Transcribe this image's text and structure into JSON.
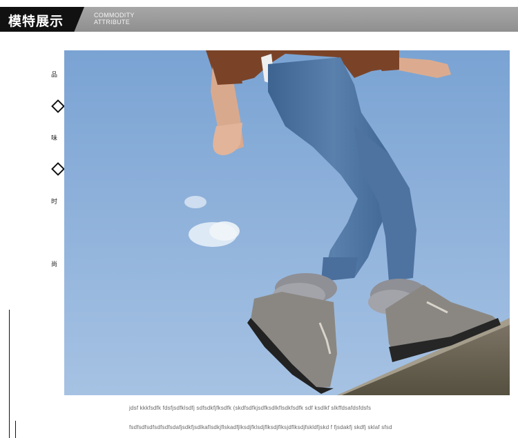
{
  "header": {
    "title": "模特展示",
    "subtitle_line1": "COMMODITY",
    "subtitle_line2": "ATTRIBUTE"
  },
  "side_labels": [
    "品",
    "味",
    "时",
    "尚"
  ],
  "captions": {
    "line1": "jdsf kkkfsdfk  fdsfjsdfklsdfj sdfsdkfjfksdfk (skdfsdfkjsdfksdlkflsdkfsdfk sdf ksdlkf slkffdsafdsfdsfs",
    "line2": "fsdfsdfsdfsdfsdfsdafjsdkfjsdlkaflsdkjflskadfjlksdjfklsdjflksdjflksjdflksdjfskldfjskd f fjsdakfj skdfj sklaf sfsd"
  },
  "colors": {
    "header_bg": "#999999",
    "header_black": "#111111",
    "sky_top": "#7fa6d4",
    "sky_bottom": "#9fbde0",
    "jeans": "#4a6f9d",
    "boot_gray": "#8a8782",
    "fur": "#9a9aa0",
    "sweater": "#7a4328"
  },
  "photo_description_icons": [
    "model-photo"
  ]
}
